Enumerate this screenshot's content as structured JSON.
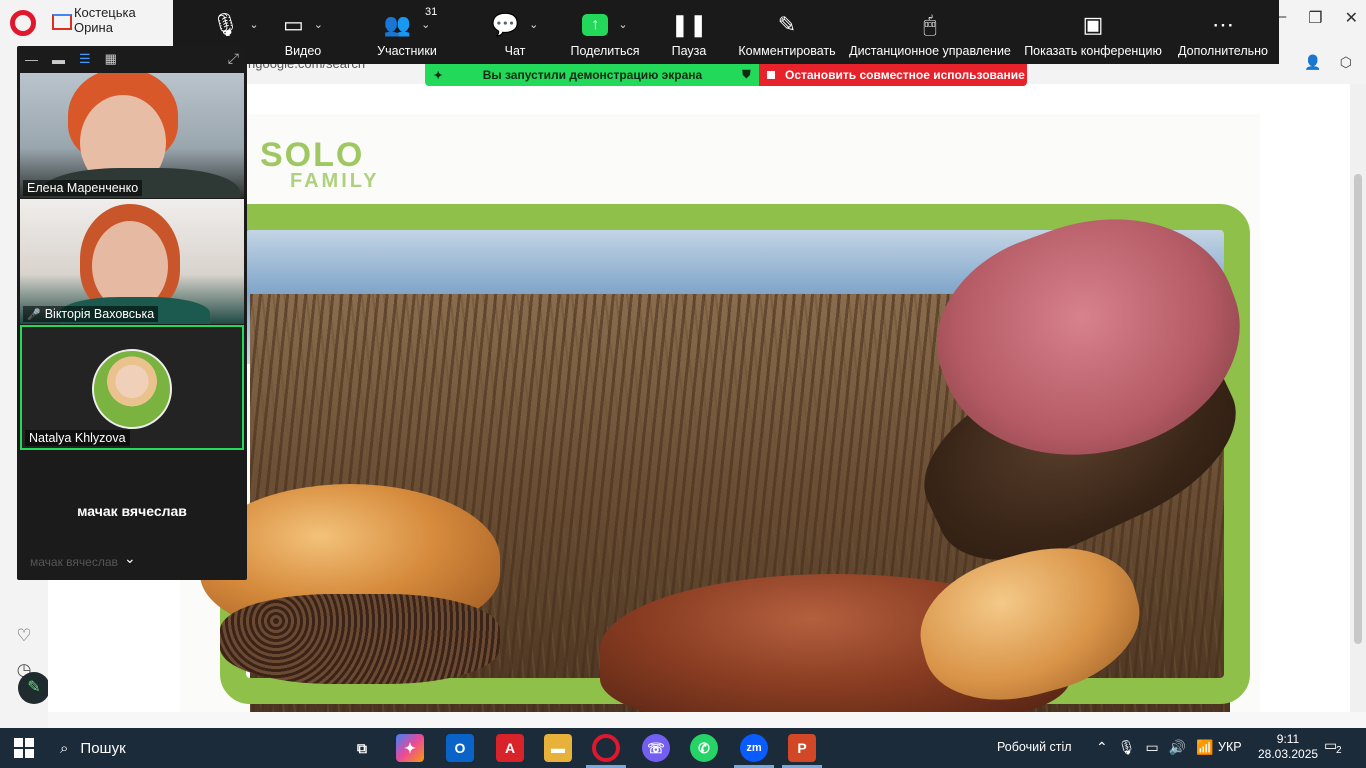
{
  "browser": {
    "tab_title": "Костецька Орина",
    "url_partial": "ngoogle.com/search",
    "win_controls": [
      "—",
      "❐",
      "✕"
    ]
  },
  "toolbar": {
    "items": [
      {
        "label": "",
        "icon": "microphone-icon"
      },
      {
        "label": "Видео",
        "icon": "video-camera-icon"
      },
      {
        "label": "Участники",
        "icon": "participants-icon",
        "badge": "31"
      },
      {
        "label": "Чат",
        "icon": "chat-icon"
      },
      {
        "label": "Поделиться",
        "icon": "share-screen-icon"
      },
      {
        "label": "Пауза",
        "icon": "pause-icon"
      },
      {
        "label": "Комментировать",
        "icon": "annotate-pen-icon"
      },
      {
        "label": "Дистанционное управление",
        "icon": "remote-control-mouse-icon"
      },
      {
        "label": "Показать конференцию",
        "icon": "show-meeting-icon"
      },
      {
        "label": "Дополнительно",
        "icon": "more-icon"
      }
    ]
  },
  "share": {
    "status_text": "Вы запустили демонстрацию экрана",
    "stop_text": "Остановить совместное использование"
  },
  "participants": [
    {
      "name": "Елена Маренченко",
      "muted": false
    },
    {
      "name": "Вікторія Ваховська",
      "muted": true
    },
    {
      "name": "Natalya Khlyzova",
      "muted": false,
      "active": true
    },
    {
      "name": "мачак вячеслав",
      "muted": true
    }
  ],
  "slide": {
    "logo_line1": "SOLO",
    "logo_line2": "FAMILY"
  },
  "taskbar": {
    "search_label": "Пошук",
    "desktop_label": "Робочий стіл",
    "language": "УКР",
    "time": "9:11",
    "date": "28.03.2025",
    "notifications": "2"
  },
  "colors": {
    "zoom_green": "#23d959",
    "stop_red": "#e8222a",
    "toolbar_bg": "#1a1a1a",
    "taskbar_bg": "#1c2b3a"
  }
}
